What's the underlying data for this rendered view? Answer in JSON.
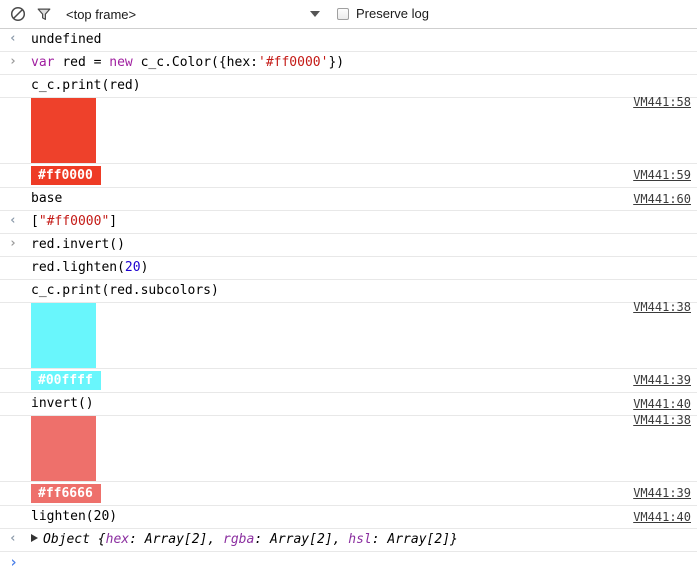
{
  "toolbar": {
    "clear_icon": "no-entry-icon",
    "filter_icon": "funnel-icon",
    "frame_selector": "<top frame>",
    "dropdown_caret": "chevron-down-icon",
    "preserve_log_label": "Preserve log",
    "preserve_log_checked": false
  },
  "colors": {
    "red_swatch": "#ee412b",
    "cyan_swatch": "#69f6fc",
    "salmon_swatch": "#ee706b",
    "badge_red_bg": "#ee3b25",
    "badge_cyan_bg": "#69f6fc",
    "badge_salmon_bg": "#ee706b",
    "string_literal": "#c41a16",
    "keyword": "#a020a0",
    "number": "#1c00cf",
    "object_property": "#8b2fa0",
    "prompt_blue": "#4a7fe8",
    "row_border": "#e8e8e8"
  },
  "rows": [
    {
      "id": "result-undefined",
      "gutter": "output",
      "kind": "text",
      "text": "undefined",
      "vmlink": ""
    },
    {
      "id": "input-create-red",
      "gutter": "input",
      "kind": "code",
      "tokens": [
        {
          "t": "var ",
          "c": "kw"
        },
        {
          "t": "red = ",
          "c": "plain"
        },
        {
          "t": "new ",
          "c": "kw"
        },
        {
          "t": "c_c.Color({hex:",
          "c": "plain"
        },
        {
          "t": "'#ff0000'",
          "c": "str"
        },
        {
          "t": "})",
          "c": "plain"
        }
      ],
      "vmlink": ""
    },
    {
      "id": "input-print-red",
      "gutter": "",
      "kind": "text",
      "text": "c_c.print(red)",
      "vmlink": ""
    },
    {
      "id": "swatch-red",
      "gutter": "",
      "kind": "swatch",
      "swatch_color": "#ee412b",
      "vmlink": "VM441:58"
    },
    {
      "id": "badge-ff0000",
      "gutter": "",
      "kind": "badge",
      "badge_text": "#ff0000",
      "badge_bg": "#ee3b25",
      "badge_fg": "#ffffff",
      "vmlink": "VM441:59"
    },
    {
      "id": "label-base",
      "gutter": "",
      "kind": "text",
      "text": "base",
      "vmlink": "VM441:60"
    },
    {
      "id": "result-array-ff0000",
      "gutter": "output",
      "kind": "code",
      "tokens": [
        {
          "t": "[",
          "c": "plain"
        },
        {
          "t": "\"#ff0000\"",
          "c": "str"
        },
        {
          "t": "]",
          "c": "plain"
        }
      ],
      "vmlink": ""
    },
    {
      "id": "input-red-invert",
      "gutter": "input",
      "kind": "text",
      "text": "red.invert()",
      "vmlink": ""
    },
    {
      "id": "input-red-lighten",
      "gutter": "",
      "kind": "code",
      "tokens": [
        {
          "t": "red.lighten(",
          "c": "plain"
        },
        {
          "t": "20",
          "c": "num"
        },
        {
          "t": ")",
          "c": "plain"
        }
      ],
      "vmlink": ""
    },
    {
      "id": "input-print-subcolors",
      "gutter": "",
      "kind": "text",
      "text": "c_c.print(red.subcolors)",
      "vmlink": ""
    },
    {
      "id": "swatch-cyan",
      "gutter": "",
      "kind": "swatch",
      "swatch_color": "#69f6fc",
      "vmlink": "VM441:38"
    },
    {
      "id": "badge-00ffff",
      "gutter": "",
      "kind": "badge",
      "badge_text": "#00ffff",
      "badge_bg": "#69f6fc",
      "badge_fg": "#ffffff",
      "vmlink": "VM441:39"
    },
    {
      "id": "label-invert",
      "gutter": "",
      "kind": "text",
      "text": "invert()",
      "vmlink": "VM441:40"
    },
    {
      "id": "swatch-salmon",
      "gutter": "",
      "kind": "swatch",
      "swatch_color": "#ee706b",
      "vmlink": "VM441:38"
    },
    {
      "id": "badge-ff6666",
      "gutter": "",
      "kind": "badge",
      "badge_text": "#ff6666",
      "badge_bg": "#ee706b",
      "badge_fg": "#ffffff",
      "vmlink": "VM441:39"
    },
    {
      "id": "label-lighten",
      "gutter": "",
      "kind": "text",
      "text": "lighten(20)",
      "vmlink": "VM441:40"
    },
    {
      "id": "result-object",
      "gutter": "output",
      "kind": "object",
      "object_tokens": [
        {
          "t": "Object {",
          "c": "plain"
        },
        {
          "t": "hex",
          "c": "prop"
        },
        {
          "t": ": Array[2], ",
          "c": "plain"
        },
        {
          "t": "rgba",
          "c": "prop"
        },
        {
          "t": ": Array[2], ",
          "c": "plain"
        },
        {
          "t": "hsl",
          "c": "prop"
        },
        {
          "t": ": Array[2]}",
          "c": "plain"
        }
      ],
      "vmlink": ""
    },
    {
      "id": "prompt-empty",
      "gutter": "prompt",
      "kind": "prompt",
      "text": "",
      "vmlink": ""
    }
  ]
}
